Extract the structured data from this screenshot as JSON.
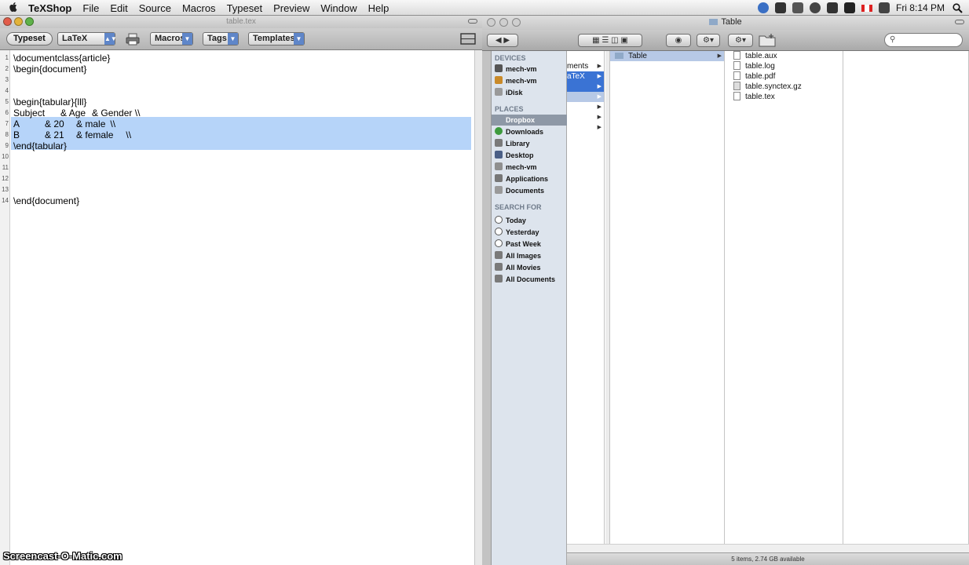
{
  "menubar": {
    "items": [
      "TeXShop",
      "File",
      "Edit",
      "Source",
      "Macros",
      "Typeset",
      "Preview",
      "Window",
      "Help"
    ],
    "clock": "Fri 8:14 PM"
  },
  "texshop": {
    "window_title": "table.tex",
    "toolbar": {
      "typeset_label": "Typeset",
      "engine_value": "LaTeX",
      "macros_label": "Macros",
      "tags_label": "Tags",
      "templates_label": "Templates"
    },
    "lines": [
      {
        "n": "1",
        "text": "\\documentclass{article}"
      },
      {
        "n": "2",
        "text": "\\begin{document}"
      },
      {
        "n": "3",
        "text": ""
      },
      {
        "n": "4",
        "text": ""
      },
      {
        "n": "5",
        "text": "\\begin{tabular}{lll}"
      },
      {
        "n": "6",
        "text": "Subject\t& Age\t& Gender \\\\"
      },
      {
        "n": "7",
        "text": "A\t\t& 20\t& male\t \\\\"
      },
      {
        "n": "8",
        "text": "B\t\t& 21\t& female\t \\\\"
      },
      {
        "n": "9",
        "text": "\\end{tabular}"
      },
      {
        "n": "10",
        "text": ""
      },
      {
        "n": "11",
        "text": ""
      },
      {
        "n": "12",
        "text": ""
      },
      {
        "n": "13",
        "text": ""
      },
      {
        "n": "14",
        "text": "\\end{document}"
      }
    ],
    "selected_lines": "7-9"
  },
  "finder": {
    "window_title": "Table",
    "sidebar": {
      "devices_header": "DEVICES",
      "devices": [
        "mech-vm",
        "mech-vm",
        "iDisk"
      ],
      "places_header": "PLACES",
      "places": [
        "Dropbox",
        "Downloads",
        "Library",
        "Desktop",
        "mech-vm",
        "Applications",
        "Documents"
      ],
      "search_header": "SEARCH FOR",
      "search": [
        "Today",
        "Yesterday",
        "Past Week",
        "All Images",
        "All Movies",
        "All Documents"
      ]
    },
    "column1": [
      "ments",
      "aTeX"
    ],
    "column2": [
      "Table"
    ],
    "files": [
      "table.aux",
      "table.log",
      "table.pdf",
      "table.synctex.gz",
      "table.tex"
    ],
    "status": "5 items, 2.74 GB available"
  },
  "watermark": "Screencast-O-Matic.com"
}
